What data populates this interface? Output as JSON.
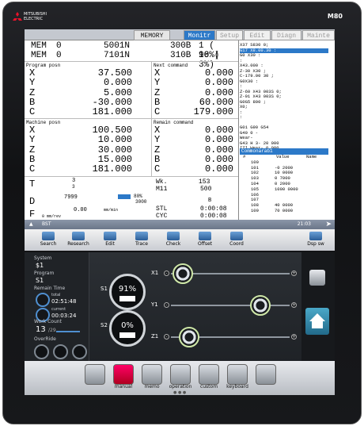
{
  "brand": {
    "line1": "MITSUBISHI",
    "line2": "ELECTRIC",
    "model": "M80"
  },
  "tabs": [
    {
      "label": "MEMORY"
    },
    {
      "label": "Monitr"
    },
    {
      "label": "Setup"
    },
    {
      "label": "Edit"
    },
    {
      "label": "Diagn"
    },
    {
      "label": "Mainte"
    }
  ],
  "mem": [
    {
      "a": "MEM",
      "b": "0",
      "c": "5001N",
      "d": "300B",
      "e": "1 ( 90%)"
    },
    {
      "a": "MEM",
      "b": "0",
      "c": "7101N",
      "d": "310B",
      "e": "16 (  3%)"
    }
  ],
  "sections": {
    "prog_posn": "Program posn",
    "next_cmd": "Next command",
    "machine_posn": "Machine posn",
    "remain_cmd": "Remain command"
  },
  "prog_posn": [
    {
      "ax": "X",
      "v": "37.500"
    },
    {
      "ax": "Y",
      "v": "0.000"
    },
    {
      "ax": "Z",
      "v": "5.000"
    },
    {
      "ax": "B",
      "v": "-30.000"
    },
    {
      "ax": "C",
      "v": "181.000"
    }
  ],
  "next_cmd": [
    {
      "ax": "X",
      "v": "0.000"
    },
    {
      "ax": "Y",
      "v": "0.000"
    },
    {
      "ax": "Z",
      "v": "0.000"
    },
    {
      "ax": "B",
      "v": "60.000"
    },
    {
      "ax": "C",
      "v": "179.000"
    }
  ],
  "machine_posn": [
    {
      "ax": "X",
      "v": "100.500"
    },
    {
      "ax": "Y",
      "v": "10.000"
    },
    {
      "ax": "Z",
      "v": "30.000"
    },
    {
      "ax": "B",
      "v": "15.000"
    },
    {
      "ax": "C",
      "v": "181.000"
    }
  ],
  "remain_cmd": [
    {
      "ax": "X",
      "v": "0.000"
    },
    {
      "ax": "Y",
      "v": "0.000"
    },
    {
      "ax": "Z",
      "v": "0.000"
    },
    {
      "ax": "B",
      "v": "0.000"
    },
    {
      "ax": "C",
      "v": "0.000"
    }
  ],
  "program_lines": [
    "X37 S830 0;",
    "G17 X8.00.30 :",
    "G0 X30 :",
    ":",
    "X43.000 :",
    "Z-30 X30 ;",
    "C-179.00 30 ;",
    "G0X30 :",
    ":",
    "Z-60 X43 003S 0;",
    "Z-91 X43 003S 0;",
    "G0G5 800 ;",
    "X0;",
    ":",
    ":"
  ],
  "modal": [
    "G01  G90 G54",
    "G40 0  -",
    "      Wear-",
    "G43 H  3-        20 000",
    "[Z]  Wear-        0 000"
  ],
  "common": {
    "title": "Commonarab1",
    "hdr_no": "#",
    "hdr_val": "Value",
    "hdr_name": "Name",
    "rows": [
      {
        "n": "100",
        "v": ""
      },
      {
        "n": "101",
        "v": "-0 2000"
      },
      {
        "n": "102",
        "v": "10 0000"
      },
      {
        "n": "103",
        "v": "0 7000"
      },
      {
        "n": "104",
        "v": "0 2000"
      },
      {
        "n": "105",
        "v": "1000 0000"
      },
      {
        "n": "106",
        "v": ""
      },
      {
        "n": "107",
        "v": ""
      },
      {
        "n": "108",
        "v": "40 0000"
      },
      {
        "n": "109",
        "v": "70 0000"
      }
    ]
  },
  "bottom": {
    "t_label": "T",
    "t_val": "3",
    "t_sub": "3",
    "d_label": "D",
    "d_val": "7999",
    "f_label": "F",
    "f_val": "0.00",
    "f_unit": "mm/min",
    "f_sub": "0   mm/rev",
    "wk_label": "Wk.",
    "wk_val": "153",
    "m11": "M11",
    "m11_val": "500",
    "stl": "STL",
    "stl_val": "0:00:08",
    "cyc": "CYC",
    "cyc_val": "0:00:08",
    "b_label": "B",
    "s_val": "80%",
    "s_sub": "3000"
  },
  "status_bar": {
    "left": "BST",
    "right": "21:03"
  },
  "fkeys": [
    {
      "label": "Search"
    },
    {
      "label": "Research"
    },
    {
      "label": "Edit"
    },
    {
      "label": "Trace"
    },
    {
      "label": "Check"
    },
    {
      "label": "Offset"
    },
    {
      "label": "Coord"
    },
    {
      "label": ""
    },
    {
      "label": "Dsp sw"
    }
  ],
  "info": {
    "system_cap": "System",
    "system_val": "$1",
    "program_cap": "Program",
    "program_val": "S1",
    "remain_cap": "Remain Time",
    "total_cap": "total",
    "total_val": "02:51:48",
    "current_cap": "current",
    "current_val": "00:03:24",
    "work_cap": "Work Count",
    "work_val": "13",
    "work_sub": "/29",
    "override_cap": "OverRide",
    "ovr": [
      "50",
      "130",
      "170"
    ]
  },
  "spindles": [
    {
      "label": "S1",
      "pct": "91%",
      "level": 0.91
    },
    {
      "label": "S2",
      "pct": "0%",
      "level": 0.0
    }
  ],
  "axes": [
    {
      "label": "X1",
      "pos": 0.1
    },
    {
      "label": "Y1",
      "pos": 0.75
    },
    {
      "label": "Z1",
      "pos": 0.15
    }
  ],
  "dock": [
    {
      "label": ""
    },
    {
      "label": "manual"
    },
    {
      "label": "memo"
    },
    {
      "label": "operation"
    },
    {
      "label": "custom"
    },
    {
      "label": "keyboard"
    },
    {
      "label": ""
    }
  ]
}
